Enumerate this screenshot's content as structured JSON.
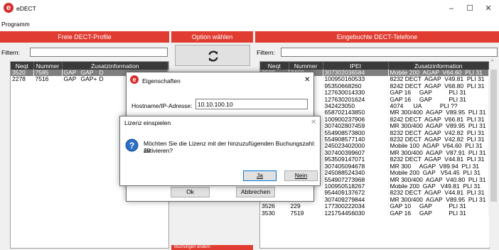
{
  "window": {
    "title": "eDECT",
    "logo": "e",
    "minimize": "–",
    "maximize": "☐",
    "close": "✕"
  },
  "menu": {
    "programm": "Programm"
  },
  "left_panel": {
    "header": "Freie DECT-Profile",
    "filter_label": "Filtern:",
    "columns": [
      "Neqt",
      "Nummer",
      "Zusatzinformation"
    ],
    "rows": [
      {
        "neqt": "3520",
        "nummer": "7585",
        "z1": "GAP",
        "z2": "GAP",
        "z3": "D",
        "selected": true
      },
      {
        "neqt": "2278",
        "nummer": "7516",
        "z1": "GAP",
        "z2": "GAP+",
        "z3": "D",
        "selected": false
      }
    ]
  },
  "middle_panel": {
    "header": "Option wählen",
    "refresh_icon": "refresh-icon",
    "bottom_label": "Buchungen ändern"
  },
  "right_panel": {
    "header": "Eingebuchte DECT-Telefone",
    "filter_label": "Filtern:",
    "columns": [
      "Neqt",
      "Nummer",
      "IPEI",
      "Zusatzinformation"
    ],
    "rows": [
      {
        "neqt": "3509",
        "nummer": "7468",
        "ipei": "307302036584",
        "info": "Mobile 200  AGAP  V64.60  PLI 31",
        "selected": true
      },
      {
        "neqt": "",
        "nummer": "",
        "ipei": "100950160533",
        "info": "8232 DECT  AGAP  V49.81  PLI 31"
      },
      {
        "neqt": "",
        "nummer": "",
        "ipei": "95350668260",
        "info": "8242 DECT  AGAP  V68.80  PLI 31"
      },
      {
        "neqt": "",
        "nummer": "",
        "ipei": "127630014330",
        "info": "GAP 16     GAP          PLI 31"
      },
      {
        "neqt": "",
        "nummer": "",
        "ipei": "127630201624",
        "info": "GAP 16     GAP          PLI 31"
      },
      {
        "neqt": "",
        "nummer": "",
        "ipei": "342423050",
        "info": "4074      UA           PLI ??"
      },
      {
        "neqt": "",
        "nummer": "",
        "ipei": "658702143850",
        "info": "MR 300/400  AGAP  V89.95  PLI 31"
      },
      {
        "neqt": "",
        "nummer": "",
        "ipei": "100900237906",
        "info": "8242 DECT  AGAP  V66.81  PLI 31"
      },
      {
        "neqt": "",
        "nummer": "",
        "ipei": "307402807459",
        "info": "MR 300/400  AGAP  V89.95  PLI 31"
      },
      {
        "neqt": "",
        "nummer": "",
        "ipei": "554908573800",
        "info": "8232 DECT  AGAP  V42.82  PLI 31"
      },
      {
        "neqt": "",
        "nummer": "",
        "ipei": "554908577140",
        "info": "8232 DECT  AGAP  V42.82  PLI 31"
      },
      {
        "neqt": "",
        "nummer": "",
        "ipei": "245023402000",
        "info": "Mobile 100  AGAP  V64.60  PLI 31"
      },
      {
        "neqt": "",
        "nummer": "",
        "ipei": "307400399607",
        "info": "MR 300/400  AGAP  V87.91  PLI 31"
      },
      {
        "neqt": "",
        "nummer": "",
        "ipei": "953509147071",
        "info": "8232 DECT  AGAP  V44.81  PLI 31"
      },
      {
        "neqt": "",
        "nummer": "",
        "ipei": "307405094678",
        "info": "MR 300     AGAP  V89.94  PLI 31"
      },
      {
        "neqt": "",
        "nummer": "",
        "ipei": "245088524340",
        "info": "Mobile 200  GAP   V54.45  PLI 31"
      },
      {
        "neqt": "",
        "nummer": "",
        "ipei": "554907273968",
        "info": "MR 300/400  AGAP  V40.80  PLI 31"
      },
      {
        "neqt": "",
        "nummer": "7554",
        "ipei": "100950518267",
        "info": "Mobile 200  GAP   V49.81  PLI 31"
      },
      {
        "neqt": "2266",
        "nummer": "7133",
        "ipei": "954409137672",
        "info": "8232 DECT  AGAP  V44.81  PLI 31"
      },
      {
        "neqt": "2280",
        "nummer": "7279",
        "ipei": "307409279844",
        "info": "MR 300/400  AGAP  V89.95  PLI 31"
      },
      {
        "neqt": "3526",
        "nummer": "229",
        "ipei": "177300222034",
        "info": "GAP 10     GAP          PLI 31"
      },
      {
        "neqt": "3530",
        "nummer": "7519",
        "ipei": "121754456030",
        "info": "GAP 16     GAP          PLI 31"
      }
    ]
  },
  "eigenschaften_dialog": {
    "title": "Eigenschaften",
    "hostname_label": "Hostname/IP-Adresse:",
    "hostname_value": "10.10.100.10",
    "ok": "Ok",
    "cancel": "Abbrechen",
    "close": "✕"
  },
  "lizenz_dialog": {
    "title": "Lizenz einspielen",
    "message_line1": "Möchten Sie die Lizenz mit der hinzuzufügenden Buchungszahl: 20",
    "message_line2": "aktivieren?",
    "yes": "Ja",
    "no": "Nein",
    "close": "✕",
    "icon": "question-icon"
  },
  "colors": {
    "accent": "#e03c31",
    "header_dark": "#3a3a3a",
    "selected_row": "#7f7f7f"
  }
}
